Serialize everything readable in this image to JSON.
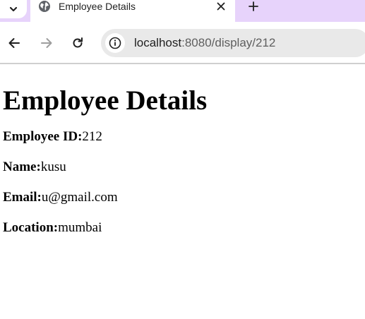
{
  "browser": {
    "tab": {
      "title": "Employee Details",
      "favicon_icon": "globe-icon"
    },
    "tab_menu_icon": "chevron-down-icon",
    "close_icon": "close-icon",
    "new_tab_icon": "plus-icon",
    "nav": {
      "back_icon": "back-arrow-icon",
      "forward_icon": "forward-arrow-icon",
      "reload_icon": "reload-icon"
    },
    "address_bar": {
      "site_info_icon": "info-icon",
      "host": "localhost",
      "rest": ":8080/display/212"
    },
    "colors": {
      "tabstrip": "#e7d3fb",
      "omnibox": "#e9e9e9"
    }
  },
  "page": {
    "heading": "Employee Details",
    "fields": [
      {
        "label": "Employee ID:",
        "value": "212"
      },
      {
        "label": "Name:",
        "value": "kusu"
      },
      {
        "label": "Email:",
        "value": "u@gmail.com"
      },
      {
        "label": "Location:",
        "value": "mumbai"
      }
    ]
  }
}
